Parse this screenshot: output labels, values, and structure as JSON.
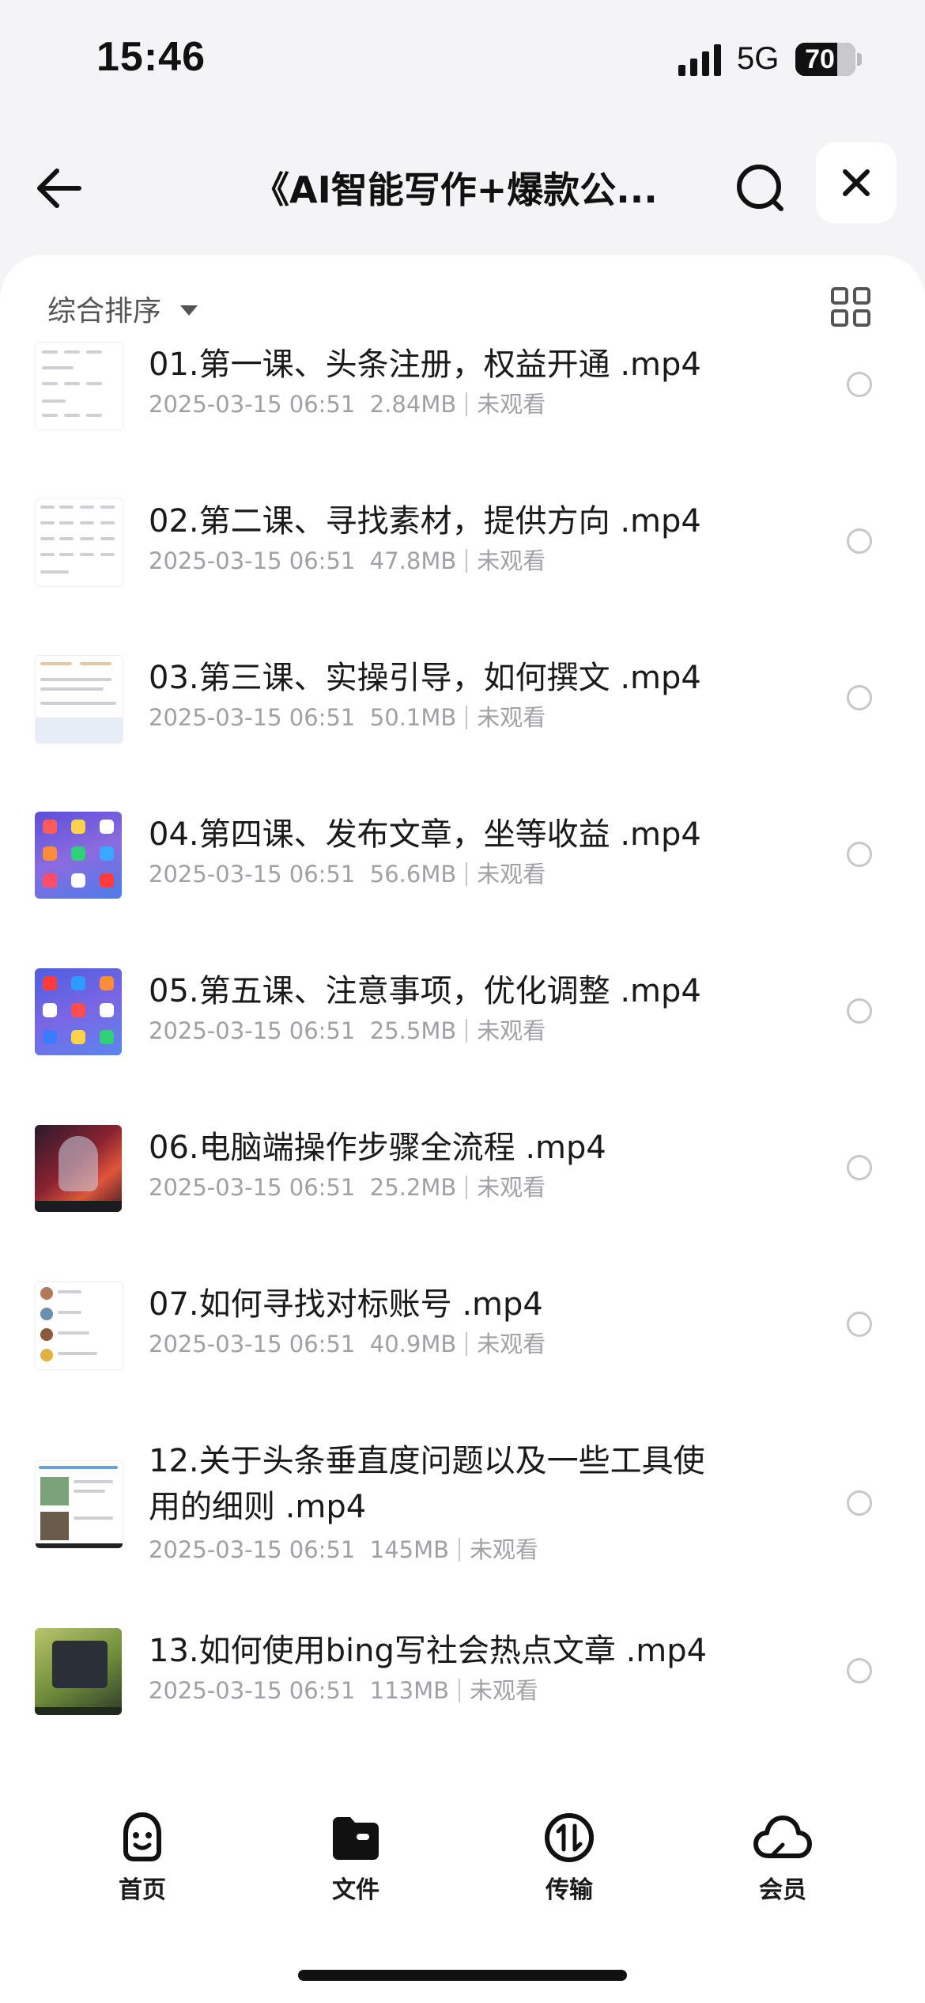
{
  "status_bar": {
    "time": "15:46",
    "network": "5G",
    "battery": "70",
    "battery_level": 0.7
  },
  "nav": {
    "title": "《AI智能写作+爆款公..."
  },
  "toolbar": {
    "sort_label": "综合排序"
  },
  "files": [
    {
      "name": "01.第一课、头条注册，权益开通 .mp4",
      "date": "2025-03-15 06:51",
      "size": "2.84MB",
      "status": "未观看"
    },
    {
      "name": "02.第二课、寻找素材，提供方向 .mp4",
      "date": "2025-03-15 06:51",
      "size": "47.8MB",
      "status": "未观看"
    },
    {
      "name": "03.第三课、实操引导，如何撰文 .mp4",
      "date": "2025-03-15 06:51",
      "size": "50.1MB",
      "status": "未观看"
    },
    {
      "name": "04.第四课、发布文章，坐等收益 .mp4",
      "date": "2025-03-15 06:51",
      "size": "56.6MB",
      "status": "未观看"
    },
    {
      "name": "05.第五课、注意事项，优化调整 .mp4",
      "date": "2025-03-15 06:51",
      "size": "25.5MB",
      "status": "未观看"
    },
    {
      "name": "06.电脑端操作步骤全流程 .mp4",
      "date": "2025-03-15 06:51",
      "size": "25.2MB",
      "status": "未观看"
    },
    {
      "name": "07.如何寻找对标账号 .mp4",
      "date": "2025-03-15 06:51",
      "size": "40.9MB",
      "status": "未观看"
    },
    {
      "name": "12.关于头条垂直度问题以及一些工具使用的细则 .mp4",
      "date": "2025-03-15 06:51",
      "size": "145MB",
      "status": "未观看"
    },
    {
      "name": "13.如何使用bing写社会热点文章 .mp4",
      "date": "2025-03-15 06:51",
      "size": "113MB",
      "status": "未观看"
    }
  ],
  "tabbar": [
    {
      "label": "首页",
      "icon": "smile-face-icon"
    },
    {
      "label": "文件",
      "icon": "folder-icon"
    },
    {
      "label": "传输",
      "icon": "transfer-icon"
    },
    {
      "label": "会员",
      "icon": "cloud-icon"
    }
  ]
}
